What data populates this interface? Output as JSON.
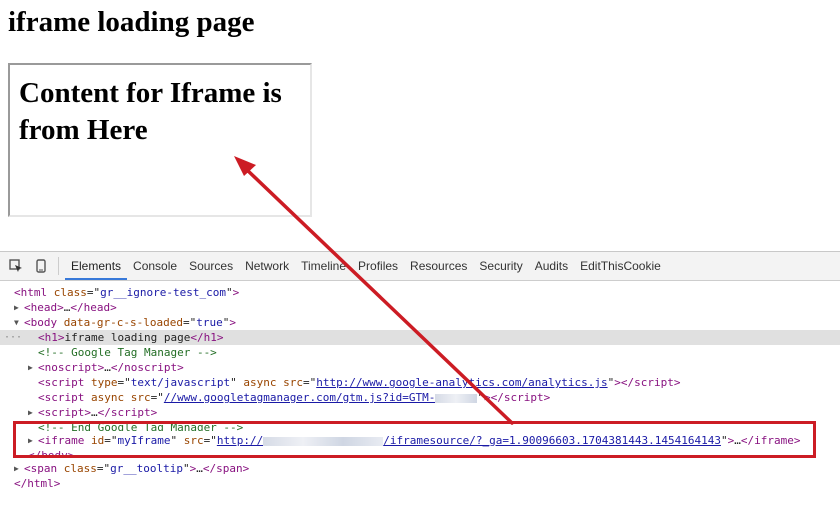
{
  "page": {
    "title": "iframe loading page",
    "iframe_content": "Content for Iframe is from Here"
  },
  "devtools": {
    "tabs": [
      "Elements",
      "Console",
      "Sources",
      "Network",
      "Timeline",
      "Profiles",
      "Resources",
      "Security",
      "Audits",
      "EditThisCookie"
    ],
    "active_tab": "Elements",
    "icons": [
      "inspect-icon",
      "device-mode-icon"
    ],
    "dom": {
      "html_open": {
        "tag": "html",
        "attr": "class",
        "value": "gr__ignore-test_com"
      },
      "head": {
        "tag": "head"
      },
      "body_open": {
        "tag": "body",
        "attr": "data-gr-c-s-loaded",
        "value": "true"
      },
      "h1": {
        "tag": "h1",
        "text": "iframe loading page"
      },
      "gtm_comment": "<!-- Google Tag Manager -->",
      "noscript": {
        "tag": "noscript"
      },
      "script1": {
        "type_value": "text/javascript",
        "async": "async",
        "src": "http://www.google-analytics.com/analytics.js"
      },
      "script2": {
        "async": "async",
        "src_prefix": "//www.googletagmanager.com/gtm.js?id=GTM-"
      },
      "script3": {
        "tag": "script"
      },
      "end_comment": "<!-- End Google Tag Manager -->",
      "iframe": {
        "id_value": "myIframe",
        "src_prefix": "http://",
        "src_suffix": "/iframesource/?_ga=1.90096603.1704381443.1454164143"
      },
      "body_close": "</body>",
      "span": {
        "tag": "span",
        "attr": "class",
        "value": "gr__tooltip"
      },
      "html_close": "</html>"
    }
  },
  "annotation": {
    "color": "#cc1c24"
  }
}
